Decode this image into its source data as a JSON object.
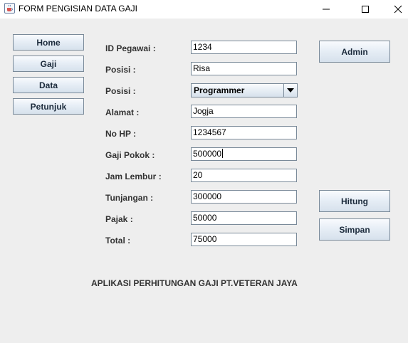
{
  "window": {
    "title": "FORM PENGISIAN DATA GAJI",
    "icon": "java-cup-icon",
    "controls": [
      "minimize-icon",
      "maximize-icon",
      "close-icon"
    ]
  },
  "nav": {
    "home": "Home",
    "gaji": "Gaji",
    "data": "Data",
    "petunjuk": "Petunjuk"
  },
  "form": {
    "id_pegawai_label": "ID Pegawai :",
    "id_pegawai_value": "1234",
    "posisi_label": "Posisi :",
    "nama_value": "Risa",
    "posisi2_label": "Posisi :",
    "posisi_selected": "Programmer",
    "alamat_label": "Alamat :",
    "alamat_value": "Jogja",
    "nohp_label": "No HP :",
    "nohp_value": "1234567",
    "gaji_pokok_label": "Gaji Pokok :",
    "gaji_pokok_value": "500000",
    "jam_lembur_label": "Jam Lembur :",
    "jam_lembur_value": "20",
    "tunjangan_label": "Tunjangan :",
    "tunjangan_value": "300000",
    "pajak_label": "Pajak :",
    "pajak_value": "50000",
    "total_label": "Total :",
    "total_value": "75000"
  },
  "actions": {
    "admin": "Admin",
    "hitung": "Hitung",
    "simpan": "Simpan"
  },
  "footer": {
    "text": "APLIKASI PERHITUNGAN GAJI PT.VETERAN JAYA"
  }
}
